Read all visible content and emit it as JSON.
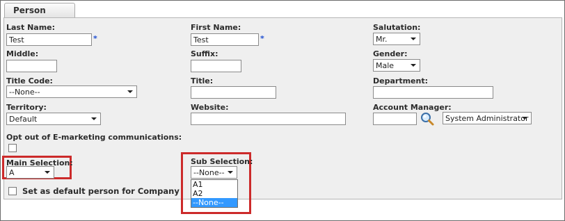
{
  "tab": {
    "label": "Person"
  },
  "fields": {
    "last_name": {
      "label": "Last Name:",
      "value": "Test",
      "required": "*"
    },
    "first_name": {
      "label": "First Name:",
      "value": "Test",
      "required": "*"
    },
    "salutation": {
      "label": "Salutation:",
      "value": "Mr."
    },
    "middle": {
      "label": "Middle:",
      "value": ""
    },
    "suffix": {
      "label": "Suffix:",
      "value": ""
    },
    "gender": {
      "label": "Gender:",
      "value": "Male"
    },
    "title_code": {
      "label": "Title Code:",
      "value": "--None--"
    },
    "title": {
      "label": "Title:",
      "value": ""
    },
    "department": {
      "label": "Department:",
      "value": ""
    },
    "territory": {
      "label": "Territory:",
      "value": "Default"
    },
    "website": {
      "label": "Website:",
      "value": ""
    },
    "account_manager": {
      "label": "Account Manager:",
      "value": "",
      "select_value": "System Administrator"
    },
    "opt_out": {
      "label": "Opt out of E-marketing communications:",
      "checked": false
    },
    "main_selection": {
      "label": "Main Selection:",
      "value": "A"
    },
    "sub_selection": {
      "label": "Sub Selection:",
      "value": "--None--",
      "options": [
        "A1",
        "A2",
        "--None--"
      ],
      "highlighted_option": "--None--"
    },
    "default_person": {
      "label": "Set as default person for Company",
      "checked": false
    }
  },
  "colors": {
    "highlight_border": "#cc2a2a",
    "selected_option": "#3399ff",
    "required_star": "#1f4fd1"
  }
}
